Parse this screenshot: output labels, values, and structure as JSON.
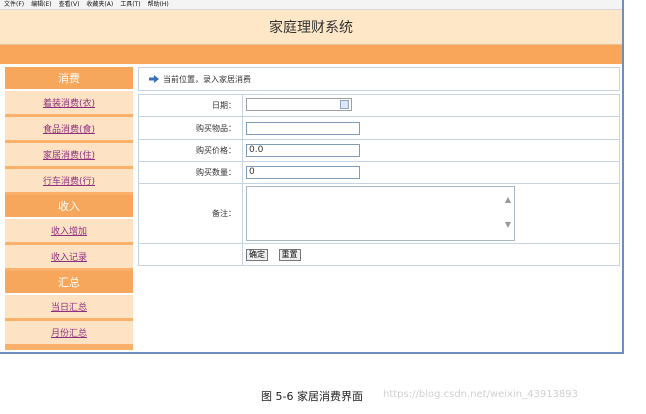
{
  "menubar": [
    "文件(F)",
    "编辑(E)",
    "查看(V)",
    "收藏夹(A)",
    "工具(T)",
    "帮助(H)"
  ],
  "header": {
    "title": "家庭理财系统"
  },
  "sidebar": {
    "sections": [
      {
        "title": "消费",
        "items": [
          "着装消费(衣)",
          "食品消费(食)",
          "家居消费(住)",
          "行车消费(行)"
        ]
      },
      {
        "title": "收入",
        "items": [
          "收入增加",
          "收入记录"
        ]
      },
      {
        "title": "汇总",
        "items": [
          "当日汇总",
          "月份汇总"
        ]
      }
    ]
  },
  "breadcrumb": {
    "text": "当前位置，录入家居消费"
  },
  "form": {
    "date_label": "日期：",
    "item_label": "购买物品：",
    "item_value": "",
    "price_label": "购买价格：",
    "price_value": "0.0",
    "qty_label": "购买数量：",
    "qty_value": "0",
    "note_label": "备注：",
    "confirm": "确定",
    "reset": "重置"
  },
  "caption": "图 5-6 家居消费界面",
  "watermark": "https://blog.csdn.net/weixin_43913893",
  "colors": {
    "accent_orange": "#f9a55a",
    "header_bg": "#fde7c7",
    "link": "#8e2f7f"
  }
}
